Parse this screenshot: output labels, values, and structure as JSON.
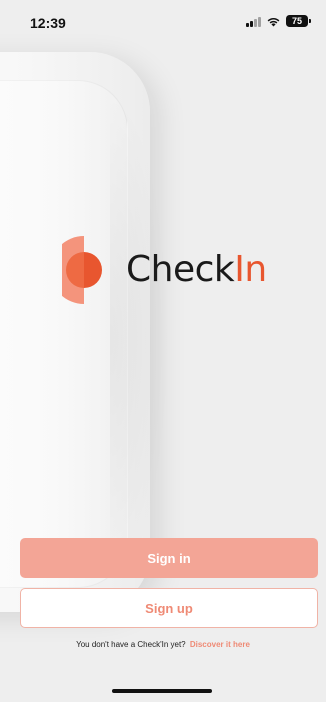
{
  "status_bar": {
    "time": "12:39",
    "battery": "75",
    "icons": [
      "signal-icon",
      "wifi-icon",
      "battery-icon"
    ]
  },
  "logo": {
    "text_main": "Check",
    "text_accent": "In",
    "icon": "checkin-logo-mark",
    "colors": {
      "accent": "#e8562f",
      "accent_light": "#f4947c",
      "text": "#1a1a1a"
    }
  },
  "actions": {
    "signin_label": "Sign in",
    "signup_label": "Sign up"
  },
  "footer": {
    "question": "You don't have a Check'In yet?",
    "link_label": "Discover it here"
  },
  "colors": {
    "primary_button": "#f3a596",
    "secondary_border": "#f0b3a6",
    "link": "#ef8a75",
    "background": "#eeeeee"
  }
}
